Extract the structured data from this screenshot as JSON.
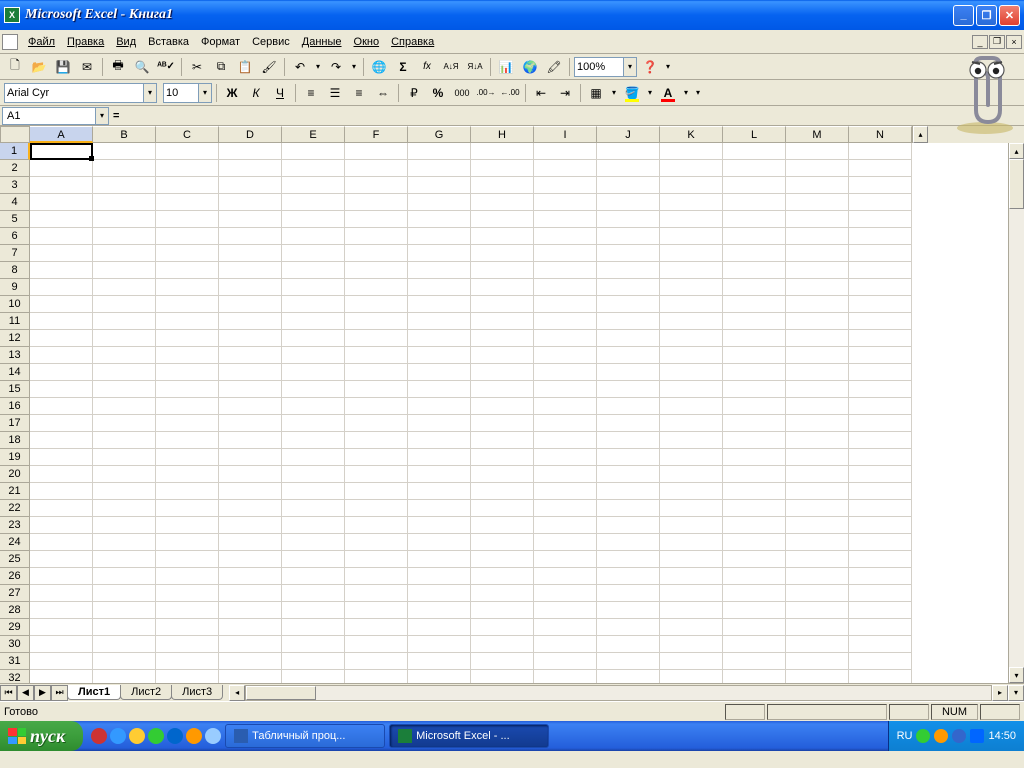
{
  "window": {
    "title": "Microsoft Excel - Книга1"
  },
  "menu": {
    "items": [
      "Файл",
      "Правка",
      "Вид",
      "Вставка",
      "Формат",
      "Сервис",
      "Данные",
      "Окно",
      "Справка"
    ]
  },
  "toolbar1": {
    "zoom": "100%"
  },
  "toolbar2": {
    "font": "Arial Cyr",
    "size": "10",
    "bold": "Ж",
    "italic": "К",
    "underline": "Ч"
  },
  "formula": {
    "cellref": "A1",
    "eq": "="
  },
  "columns": [
    "A",
    "B",
    "C",
    "D",
    "E",
    "F",
    "G",
    "H",
    "I",
    "J",
    "K",
    "L",
    "M",
    "N"
  ],
  "rows_count": 32,
  "active_cell": "A1",
  "sheets": {
    "tabs": [
      "Лист1",
      "Лист2",
      "Лист3"
    ],
    "active": 0
  },
  "status": {
    "ready": "Готово",
    "num": "NUM"
  },
  "taskbar": {
    "start": "пуск",
    "items": [
      {
        "label": "Табличный проц...",
        "icon": "word"
      },
      {
        "label": "Microsoft Excel - ...",
        "icon": "excel"
      }
    ],
    "lang": "RU",
    "time": "14:50"
  }
}
